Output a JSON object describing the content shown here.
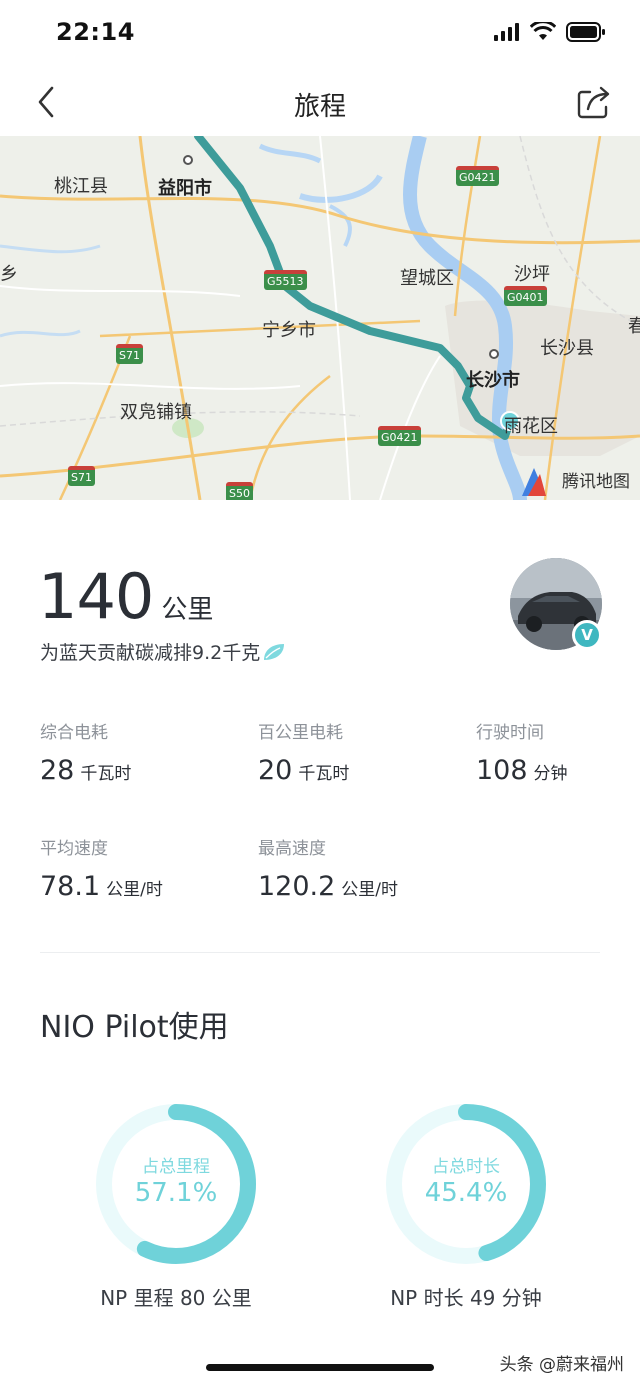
{
  "status": {
    "time": "22:14"
  },
  "nav": {
    "title": "旅程"
  },
  "map": {
    "labels": [
      "桃江县",
      "益阳市",
      "乡",
      "望城区",
      "沙坪",
      "宁乡市",
      "长沙县",
      "长沙市",
      "双凫铺镇",
      "雨花区",
      "春"
    ],
    "roads": [
      "G0421",
      "G5513",
      "G0401",
      "S71",
      "G0421",
      "S71",
      "S50"
    ],
    "logo": "腾讯地图"
  },
  "trip": {
    "distance_value": "140",
    "distance_unit": "公里",
    "carbon_text": "为蓝天贡献碳减排9.2千克"
  },
  "stats": [
    {
      "label": "综合电耗",
      "value": "28",
      "unit": "千瓦时"
    },
    {
      "label": "百公里电耗",
      "value": "20",
      "unit": "千瓦时"
    },
    {
      "label": "行驶时间",
      "value": "108",
      "unit": "分钟"
    },
    {
      "label": "平均速度",
      "value": "78.1",
      "unit": "公里/时"
    },
    {
      "label": "最高速度",
      "value": "120.2",
      "unit": "公里/时"
    }
  ],
  "pilot": {
    "title": "NIO Pilot使用",
    "rings": [
      {
        "label": "占总里程",
        "percent": "57.1%",
        "fraction": 0.571,
        "caption": "NP 里程 80 公里"
      },
      {
        "label": "占总时长",
        "percent": "45.4%",
        "fraction": 0.454,
        "caption": "NP 时长 49 分钟"
      }
    ]
  },
  "watermark": "头条 @蔚来福州",
  "colors": {
    "accent": "#6fd2d9",
    "route": "#3e9c9a",
    "ring_track": "#eafafb"
  }
}
